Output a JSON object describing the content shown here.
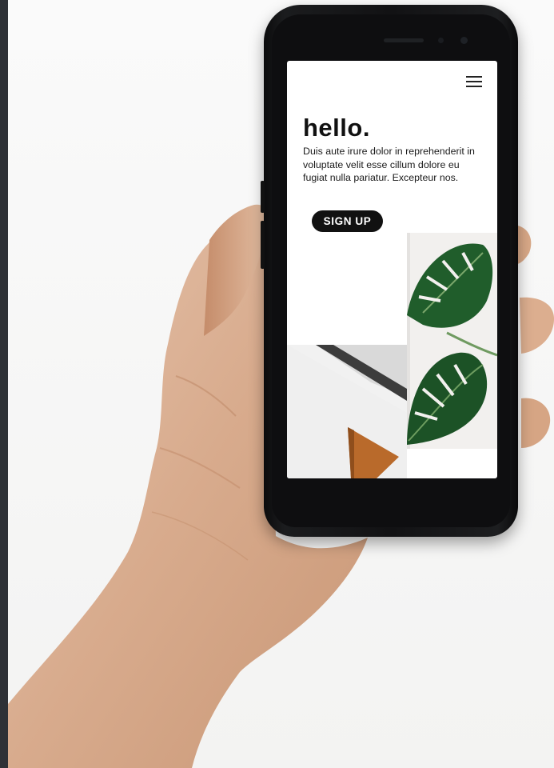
{
  "screen": {
    "headline": "hello.",
    "body": "Duis aute irure dolor in reprehenderit in voluptate velit esse cillum dolore eu fugiat nulla pariatur. Excepteur nos.",
    "signup_label": "SIGN UP",
    "menu_icon": "hamburger-menu-icon"
  },
  "colors": {
    "button_bg": "#111111",
    "button_text": "#ffffff",
    "leaf": "#1f5a2a",
    "wood": "#b86a2c"
  }
}
